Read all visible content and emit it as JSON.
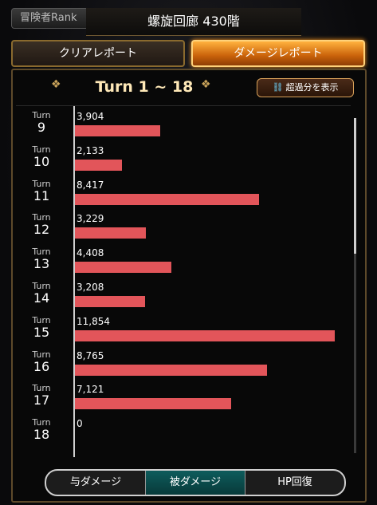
{
  "header": {
    "rank_label": "冒険者Rank",
    "title": "螺旋回廊 430階"
  },
  "tabs": [
    {
      "label": "クリアレポート",
      "active": false
    },
    {
      "label": "ダメージレポート",
      "active": true
    }
  ],
  "turn_range": "Turn 1 ~ 18",
  "overflow_button": "超過分を表示",
  "turn_word": "Turn",
  "chart_data": {
    "type": "bar",
    "orientation": "horizontal",
    "categories": [
      "9",
      "10",
      "11",
      "12",
      "13",
      "14",
      "15",
      "16",
      "17",
      "18"
    ],
    "values": [
      3904,
      2133,
      8417,
      3229,
      4408,
      3208,
      11854,
      8765,
      7121,
      0
    ],
    "value_labels": [
      "3,904",
      "2,133",
      "8,417",
      "3,229",
      "4,408",
      "3,208",
      "11,854",
      "8,765",
      "7,121",
      "0"
    ],
    "bar_color": "#e2555a"
  },
  "bottom_tabs": [
    {
      "label": "与ダメージ",
      "active": false
    },
    {
      "label": "被ダメージ",
      "active": true
    },
    {
      "label": "HP回復",
      "active": false
    }
  ]
}
